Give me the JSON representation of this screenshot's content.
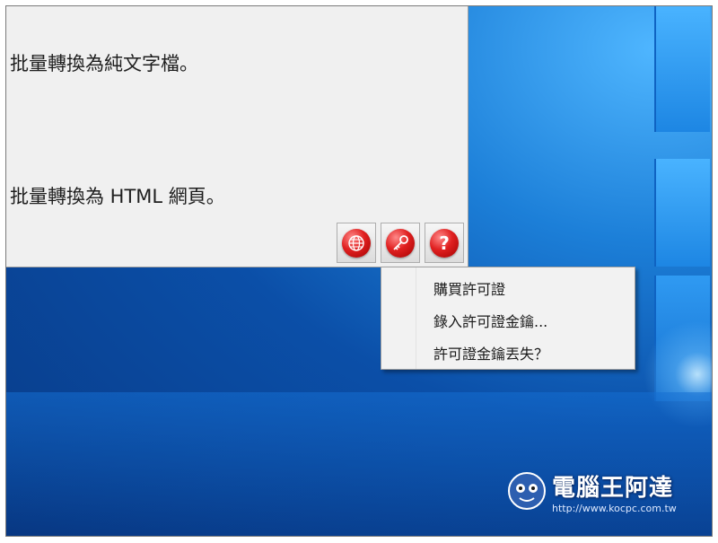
{
  "dialog": {
    "line1": "批量轉換為純文字檔。",
    "line2": "批量轉換為 HTML 網頁。"
  },
  "toolbar": {
    "buttons": [
      {
        "icon": "globe-icon",
        "color": "#e02020"
      },
      {
        "icon": "key-icon",
        "color": "#e02020"
      },
      {
        "icon": "help-icon",
        "glyph": "?",
        "color": "#e02020"
      }
    ]
  },
  "context_menu": {
    "items": [
      "購買許可證",
      "錄入許可證金鑰...",
      "許可證金鑰丟失？"
    ]
  },
  "watermark": {
    "title": "電腦王阿達",
    "url": "http://www.kocpc.com.tw"
  },
  "colors": {
    "desktop": "#0b4fa8",
    "dialog_bg": "#f0f0f0",
    "button_red": "#e02020"
  }
}
